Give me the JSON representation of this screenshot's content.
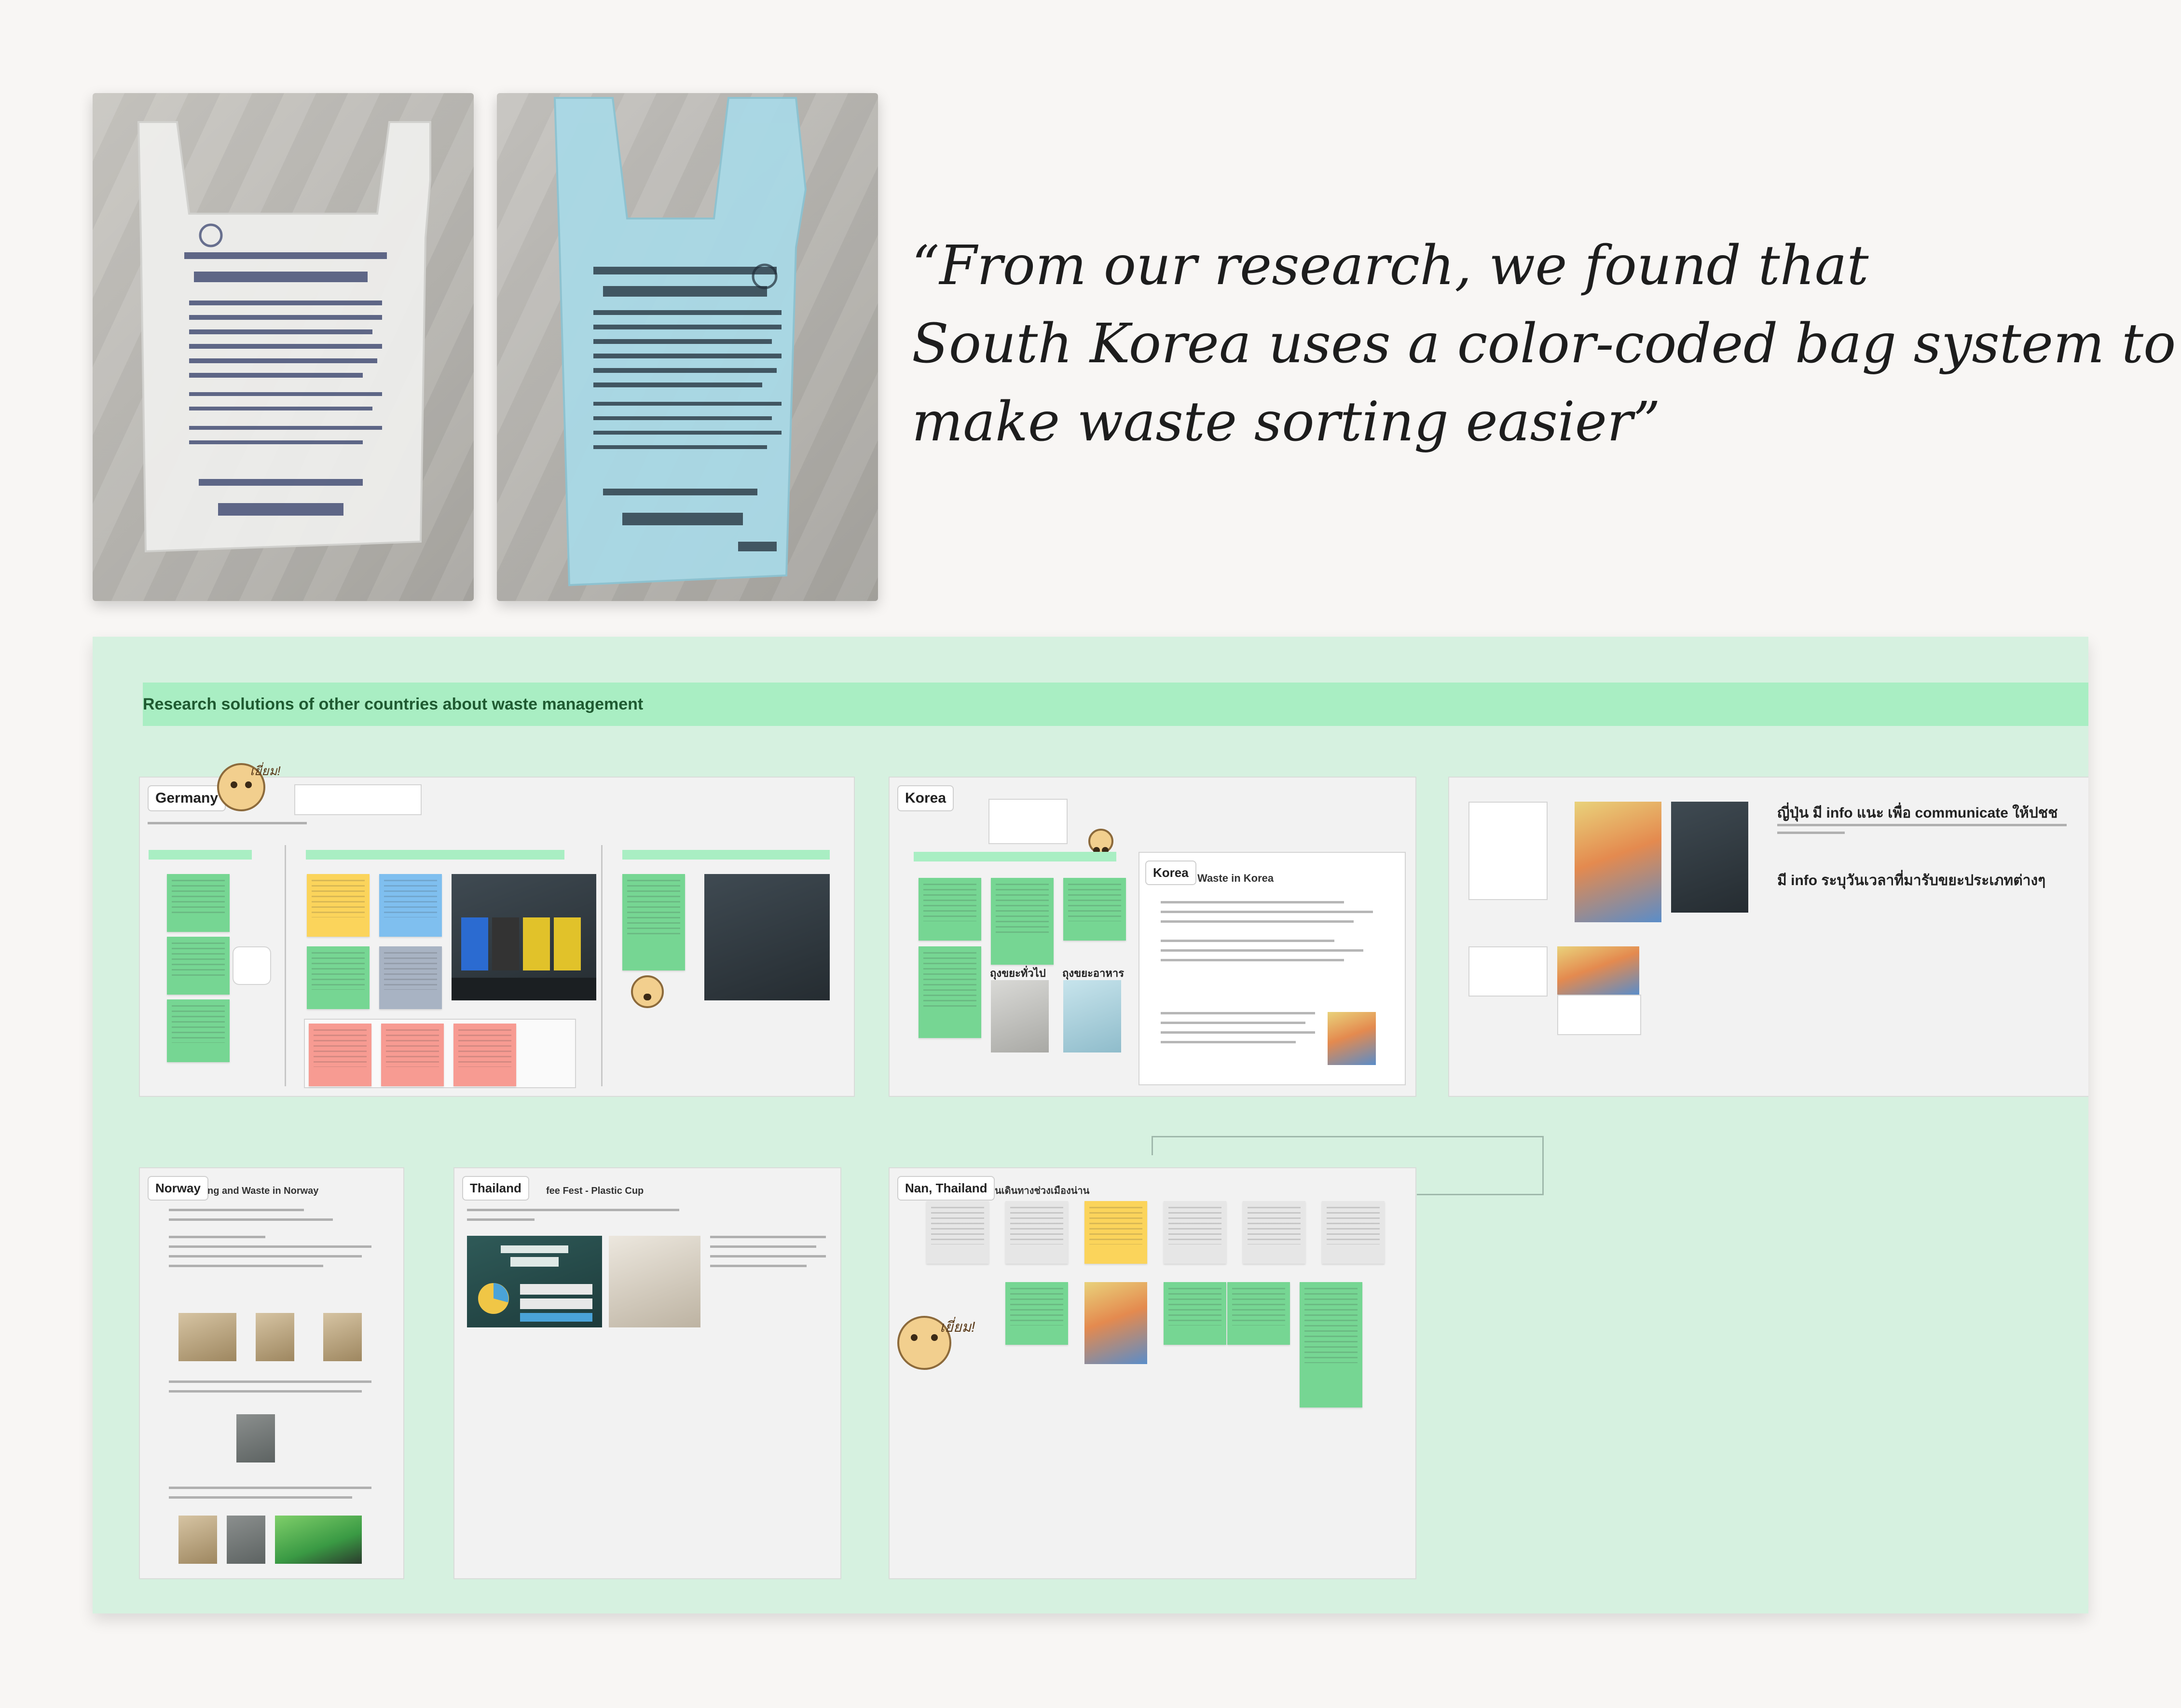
{
  "quote": {
    "line1": "“From our research, we found that",
    "line2": "South Korea uses a color-coded bag system to",
    "line3": "make waste sorting easier”"
  },
  "board": {
    "title": "Research solutions of other countries about waste management",
    "sections": {
      "germany": {
        "tag": "Germany"
      },
      "korea": {
        "tag": "Korea",
        "inner_tag": "Korea",
        "inner_title": "Waste in Korea",
        "label_general": "ถุงขยะทั่วไป",
        "label_food": "ถุงขยะอาหาร"
      },
      "japan": {
        "heading": "ญี่ปุ่น มี info แนะ เพื่อ communicate ให้ปชช",
        "subheading": "มี info ระบุวันเวลาที่มารับขยะประเภทต่างๆ"
      },
      "norway": {
        "tag": "Norway",
        "title": "ng and Waste in Norway"
      },
      "thailand": {
        "tag": "Thailand",
        "title": "fee Fest - Plastic Cup"
      },
      "nan": {
        "tag": "Nan, Thailand",
        "title": "นเดินทางช่วงเมืองน่าน"
      }
    },
    "mascot_text": "เยี่ยม!"
  },
  "colors": {
    "board_bg": "#d6f1e0",
    "title_bar": "#a9eec3",
    "sticky_green": "#76d693",
    "sticky_yellow": "#fbd45b",
    "sticky_red": "#f79b92"
  }
}
